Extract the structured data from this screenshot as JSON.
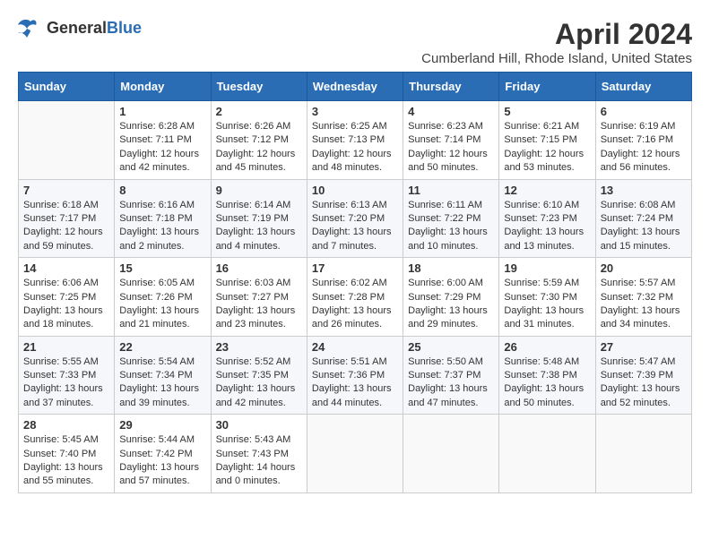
{
  "logo": {
    "general": "General",
    "blue": "Blue"
  },
  "title": "April 2024",
  "subtitle": "Cumberland Hill, Rhode Island, United States",
  "headers": [
    "Sunday",
    "Monday",
    "Tuesday",
    "Wednesday",
    "Thursday",
    "Friday",
    "Saturday"
  ],
  "weeks": [
    [
      {
        "day": "",
        "info": ""
      },
      {
        "day": "1",
        "info": "Sunrise: 6:28 AM\nSunset: 7:11 PM\nDaylight: 12 hours\nand 42 minutes."
      },
      {
        "day": "2",
        "info": "Sunrise: 6:26 AM\nSunset: 7:12 PM\nDaylight: 12 hours\nand 45 minutes."
      },
      {
        "day": "3",
        "info": "Sunrise: 6:25 AM\nSunset: 7:13 PM\nDaylight: 12 hours\nand 48 minutes."
      },
      {
        "day": "4",
        "info": "Sunrise: 6:23 AM\nSunset: 7:14 PM\nDaylight: 12 hours\nand 50 minutes."
      },
      {
        "day": "5",
        "info": "Sunrise: 6:21 AM\nSunset: 7:15 PM\nDaylight: 12 hours\nand 53 minutes."
      },
      {
        "day": "6",
        "info": "Sunrise: 6:19 AM\nSunset: 7:16 PM\nDaylight: 12 hours\nand 56 minutes."
      }
    ],
    [
      {
        "day": "7",
        "info": "Sunrise: 6:18 AM\nSunset: 7:17 PM\nDaylight: 12 hours\nand 59 minutes."
      },
      {
        "day": "8",
        "info": "Sunrise: 6:16 AM\nSunset: 7:18 PM\nDaylight: 13 hours\nand 2 minutes."
      },
      {
        "day": "9",
        "info": "Sunrise: 6:14 AM\nSunset: 7:19 PM\nDaylight: 13 hours\nand 4 minutes."
      },
      {
        "day": "10",
        "info": "Sunrise: 6:13 AM\nSunset: 7:20 PM\nDaylight: 13 hours\nand 7 minutes."
      },
      {
        "day": "11",
        "info": "Sunrise: 6:11 AM\nSunset: 7:22 PM\nDaylight: 13 hours\nand 10 minutes."
      },
      {
        "day": "12",
        "info": "Sunrise: 6:10 AM\nSunset: 7:23 PM\nDaylight: 13 hours\nand 13 minutes."
      },
      {
        "day": "13",
        "info": "Sunrise: 6:08 AM\nSunset: 7:24 PM\nDaylight: 13 hours\nand 15 minutes."
      }
    ],
    [
      {
        "day": "14",
        "info": "Sunrise: 6:06 AM\nSunset: 7:25 PM\nDaylight: 13 hours\nand 18 minutes."
      },
      {
        "day": "15",
        "info": "Sunrise: 6:05 AM\nSunset: 7:26 PM\nDaylight: 13 hours\nand 21 minutes."
      },
      {
        "day": "16",
        "info": "Sunrise: 6:03 AM\nSunset: 7:27 PM\nDaylight: 13 hours\nand 23 minutes."
      },
      {
        "day": "17",
        "info": "Sunrise: 6:02 AM\nSunset: 7:28 PM\nDaylight: 13 hours\nand 26 minutes."
      },
      {
        "day": "18",
        "info": "Sunrise: 6:00 AM\nSunset: 7:29 PM\nDaylight: 13 hours\nand 29 minutes."
      },
      {
        "day": "19",
        "info": "Sunrise: 5:59 AM\nSunset: 7:30 PM\nDaylight: 13 hours\nand 31 minutes."
      },
      {
        "day": "20",
        "info": "Sunrise: 5:57 AM\nSunset: 7:32 PM\nDaylight: 13 hours\nand 34 minutes."
      }
    ],
    [
      {
        "day": "21",
        "info": "Sunrise: 5:55 AM\nSunset: 7:33 PM\nDaylight: 13 hours\nand 37 minutes."
      },
      {
        "day": "22",
        "info": "Sunrise: 5:54 AM\nSunset: 7:34 PM\nDaylight: 13 hours\nand 39 minutes."
      },
      {
        "day": "23",
        "info": "Sunrise: 5:52 AM\nSunset: 7:35 PM\nDaylight: 13 hours\nand 42 minutes."
      },
      {
        "day": "24",
        "info": "Sunrise: 5:51 AM\nSunset: 7:36 PM\nDaylight: 13 hours\nand 44 minutes."
      },
      {
        "day": "25",
        "info": "Sunrise: 5:50 AM\nSunset: 7:37 PM\nDaylight: 13 hours\nand 47 minutes."
      },
      {
        "day": "26",
        "info": "Sunrise: 5:48 AM\nSunset: 7:38 PM\nDaylight: 13 hours\nand 50 minutes."
      },
      {
        "day": "27",
        "info": "Sunrise: 5:47 AM\nSunset: 7:39 PM\nDaylight: 13 hours\nand 52 minutes."
      }
    ],
    [
      {
        "day": "28",
        "info": "Sunrise: 5:45 AM\nSunset: 7:40 PM\nDaylight: 13 hours\nand 55 minutes."
      },
      {
        "day": "29",
        "info": "Sunrise: 5:44 AM\nSunset: 7:42 PM\nDaylight: 13 hours\nand 57 minutes."
      },
      {
        "day": "30",
        "info": "Sunrise: 5:43 AM\nSunset: 7:43 PM\nDaylight: 14 hours\nand 0 minutes."
      },
      {
        "day": "",
        "info": ""
      },
      {
        "day": "",
        "info": ""
      },
      {
        "day": "",
        "info": ""
      },
      {
        "day": "",
        "info": ""
      }
    ]
  ]
}
